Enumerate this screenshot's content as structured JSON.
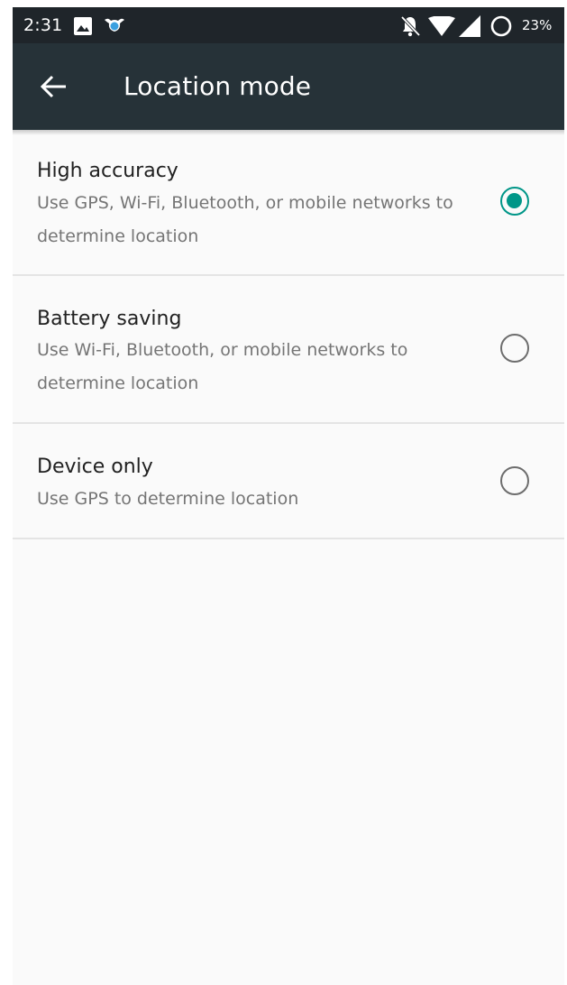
{
  "status_bar": {
    "time": "2:31",
    "battery_percent": "23%",
    "icons": [
      "image-notification-icon",
      "bird-notification-icon",
      "muted-bell-icon",
      "wifi-icon",
      "cell-signal-icon",
      "battery-icon"
    ]
  },
  "toolbar": {
    "title": "Location mode",
    "back_icon": "back-arrow-icon"
  },
  "options": [
    {
      "title": "High accuracy",
      "description": "Use GPS, Wi-Fi, Bluetooth, or mobile networks to determine location",
      "selected": true
    },
    {
      "title": "Battery saving",
      "description": "Use Wi-Fi, Bluetooth, or mobile networks to determine location",
      "selected": false
    },
    {
      "title": "Device only",
      "description": "Use GPS to determine location",
      "selected": false
    }
  ],
  "colors": {
    "toolbar": "#263238",
    "status_bar": "#1f252a",
    "accent": "#009688",
    "background": "#fafafa"
  }
}
